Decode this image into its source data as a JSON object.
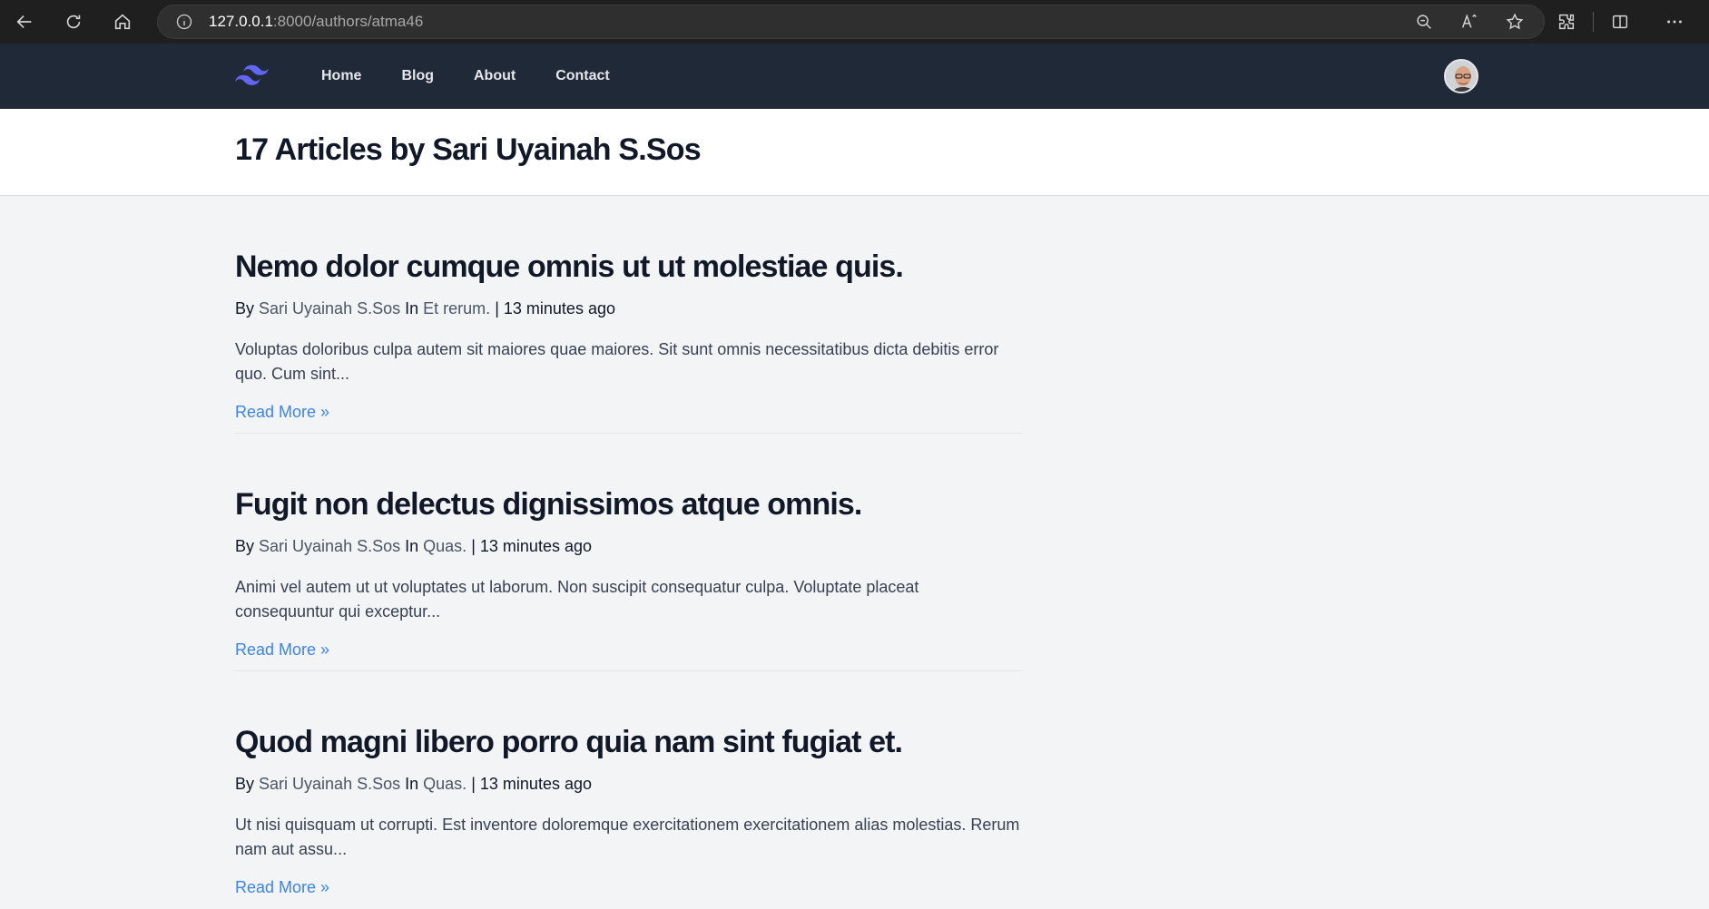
{
  "browser": {
    "url_host": "127.0.0.1",
    "url_rest": ":8000/authors/atma46",
    "icons": [
      "back-icon",
      "refresh-icon",
      "home-icon",
      "info-icon",
      "zoom-out-icon",
      "read-aloud-icon",
      "favorite-star-icon",
      "extensions-icon",
      "split-screen-icon",
      "more-options-icon"
    ]
  },
  "site": {
    "logo": "tailwind-logo-icon",
    "nav": [
      {
        "label": "Home"
      },
      {
        "label": "Blog"
      },
      {
        "label": "About"
      },
      {
        "label": "Contact"
      }
    ],
    "accent_color": "#3b82f6",
    "nav_bg_color": "#1f2937"
  },
  "page": {
    "title": "17 Articles by Sari Uyainah S.Sos"
  },
  "articles": [
    {
      "title": "Nemo dolor cumque omnis ut ut molestiae quis.",
      "by": "By",
      "author": "Sari Uyainah S.Sos",
      "in": "In",
      "category": "Et rerum.",
      "separator": "|",
      "time": "13 minutes ago",
      "excerpt": "Voluptas doloribus culpa autem sit maiores quae maiores. Sit sunt omnis necessitatibus dicta debitis error quo. Cum sint...",
      "read_more": "Read More »"
    },
    {
      "title": "Fugit non delectus dignissimos atque omnis.",
      "by": "By",
      "author": "Sari Uyainah S.Sos",
      "in": "In",
      "category": "Quas.",
      "separator": "|",
      "time": "13 minutes ago",
      "excerpt": "Animi vel autem ut ut voluptates ut laborum. Non suscipit consequatur culpa. Voluptate placeat consequuntur qui exceptur...",
      "read_more": "Read More »"
    },
    {
      "title": "Quod magni libero porro quia nam sint fugiat et.",
      "by": "By",
      "author": "Sari Uyainah S.Sos",
      "in": "In",
      "category": "Quas.",
      "separator": "|",
      "time": "13 minutes ago",
      "excerpt": "Ut nisi quisquam ut corrupti. Est inventore doloremque exercitationem exercitationem alias molestias. Rerum nam aut assu...",
      "read_more": "Read More »"
    }
  ]
}
